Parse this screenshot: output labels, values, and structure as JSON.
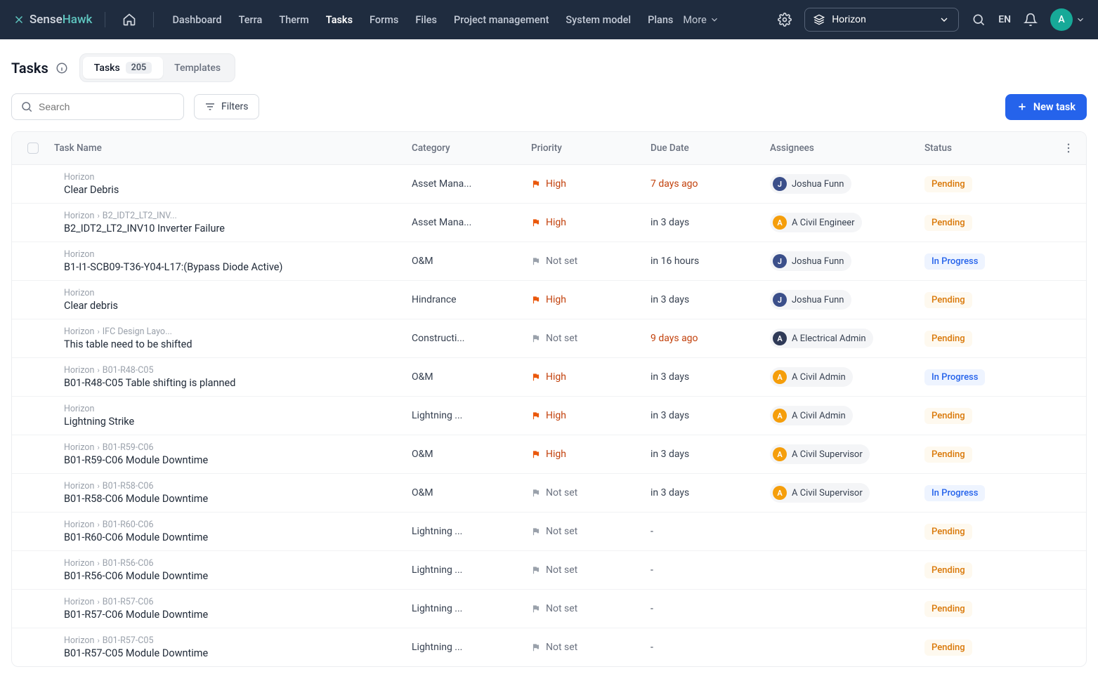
{
  "brand": {
    "sense": "Sense",
    "hawk": "Hawk"
  },
  "nav": {
    "items": [
      "Dashboard",
      "Terra",
      "Therm",
      "Tasks",
      "Forms",
      "Files",
      "Project management",
      "System model",
      "Plans"
    ],
    "more": "More",
    "lang": "EN",
    "project": "Horizon",
    "avatar_initial": "A"
  },
  "page": {
    "title": "Tasks",
    "tabs": {
      "tasks": "Tasks",
      "count": "205",
      "templates": "Templates"
    },
    "search_placeholder": "Search",
    "filters": "Filters",
    "new_task": "New task"
  },
  "columns": {
    "name": "Task Name",
    "category": "Category",
    "priority": "Priority",
    "due": "Due Date",
    "assignees": "Assignees",
    "status": "Status"
  },
  "priorities": {
    "high": "High",
    "notset": "Not set"
  },
  "statuses": {
    "pending": "Pending",
    "in_progress": "In Progress"
  },
  "rows": [
    {
      "crumb": [
        "Horizon"
      ],
      "name": "Clear Debris",
      "category": "Asset Mana...",
      "priority": "high",
      "due": "7 days ago",
      "overdue": true,
      "assignee": {
        "initial": "J",
        "name": "Joshua Funn",
        "cls": "as-blue"
      },
      "status": "pending"
    },
    {
      "crumb": [
        "Horizon",
        "B2_IDT2_LT2_INV..."
      ],
      "name": "B2_IDT2_LT2_INV10 Inverter Failure",
      "category": "Asset Mana...",
      "priority": "high",
      "due": "in 3 days",
      "overdue": false,
      "assignee": {
        "initial": "A",
        "name": "A Civil Engineer",
        "cls": "as-orange"
      },
      "status": "pending"
    },
    {
      "crumb": [
        "Horizon"
      ],
      "name": "B1-I1-SCB09-T36-Y04-L17:(Bypass Diode Active)",
      "category": "O&M",
      "priority": "notset",
      "due": "in 16 hours",
      "overdue": false,
      "assignee": {
        "initial": "J",
        "name": "Joshua Funn",
        "cls": "as-blue"
      },
      "status": "in_progress"
    },
    {
      "crumb": [
        "Horizon"
      ],
      "name": "Clear debris",
      "category": "Hindrance",
      "priority": "high",
      "due": "in 3 days",
      "overdue": false,
      "assignee": {
        "initial": "J",
        "name": "Joshua Funn",
        "cls": "as-blue"
      },
      "status": "pending"
    },
    {
      "crumb": [
        "Horizon",
        "IFC Design Layo..."
      ],
      "name": "This table need to be shifted",
      "category": "Constructi...",
      "priority": "notset",
      "due": "9 days ago",
      "overdue": true,
      "assignee": {
        "initial": "A",
        "name": "A Electrical Admin",
        "cls": "as-navy"
      },
      "status": "pending"
    },
    {
      "crumb": [
        "Horizon",
        "B01-R48-C05"
      ],
      "name": "B01-R48-C05 Table shifting is planned",
      "category": "O&M",
      "priority": "high",
      "due": "in 3 days",
      "overdue": false,
      "assignee": {
        "initial": "A",
        "name": "A Civil Admin",
        "cls": "as-orange"
      },
      "status": "in_progress"
    },
    {
      "crumb": [
        "Horizon"
      ],
      "name": "Lightning Strike",
      "category": "Lightning ...",
      "priority": "high",
      "due": "in 3 days",
      "overdue": false,
      "assignee": {
        "initial": "A",
        "name": "A Civil Admin",
        "cls": "as-orange"
      },
      "status": "pending"
    },
    {
      "crumb": [
        "Horizon",
        "B01-R59-C06"
      ],
      "name": "B01-R59-C06 Module Downtime",
      "category": "O&M",
      "priority": "high",
      "due": "in 3 days",
      "overdue": false,
      "assignee": {
        "initial": "A",
        "name": "A Civil Supervisor",
        "cls": "as-orange"
      },
      "status": "pending"
    },
    {
      "crumb": [
        "Horizon",
        "B01-R58-C06"
      ],
      "name": "B01-R58-C06 Module Downtime",
      "category": "O&M",
      "priority": "notset",
      "due": "in 3 days",
      "overdue": false,
      "assignee": {
        "initial": "A",
        "name": "A Civil Supervisor",
        "cls": "as-orange"
      },
      "status": "in_progress"
    },
    {
      "crumb": [
        "Horizon",
        "B01-R60-C06"
      ],
      "name": "B01-R60-C06 Module Downtime",
      "category": "Lightning ...",
      "priority": "notset",
      "due": "-",
      "overdue": false,
      "assignee": null,
      "status": "pending"
    },
    {
      "crumb": [
        "Horizon",
        "B01-R56-C06"
      ],
      "name": "B01-R56-C06 Module Downtime",
      "category": "Lightning ...",
      "priority": "notset",
      "due": "-",
      "overdue": false,
      "assignee": null,
      "status": "pending"
    },
    {
      "crumb": [
        "Horizon",
        "B01-R57-C06"
      ],
      "name": "B01-R57-C06 Module Downtime",
      "category": "Lightning ...",
      "priority": "notset",
      "due": "-",
      "overdue": false,
      "assignee": null,
      "status": "pending"
    },
    {
      "crumb": [
        "Horizon",
        "B01-R57-C05"
      ],
      "name": "B01-R57-C05 Module Downtime",
      "category": "Lightning ...",
      "priority": "notset",
      "due": "-",
      "overdue": false,
      "assignee": null,
      "status": "pending"
    }
  ]
}
